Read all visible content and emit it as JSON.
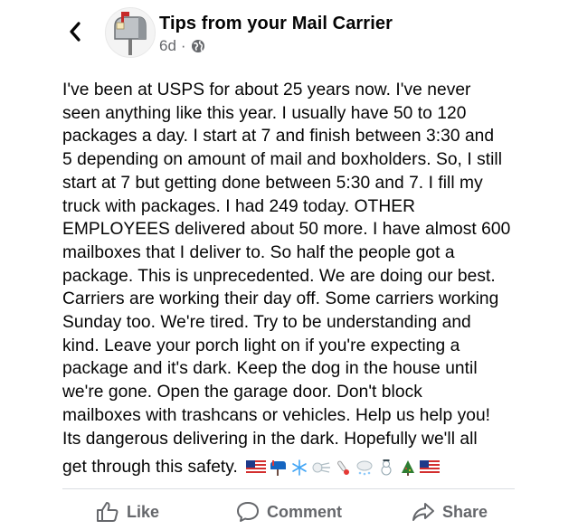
{
  "header": {
    "page_name": "Tips from your Mail Carrier",
    "timestamp": "6d",
    "separator": "·",
    "audience_icon": "globe-icon",
    "back_icon": "chevron-left-icon",
    "avatar_icon": "mailbox-avatar"
  },
  "post": {
    "lines": [
      "I've been at USPS for about 25 years now. I've never",
      "seen anything like this year.  I usually have 50 to 120",
      "packages a day. I start at 7 and finish between 3:30 and",
      "5 depending on amount of mail and boxholders. So, I still",
      "start at 7 but getting done between 5:30 and 7. I fill my",
      "truck with packages.  I had 249 today. OTHER",
      "EMPLOYEES delivered about 50 more. I have almost 600",
      "mailboxes that I deliver to.  So half the people got a",
      "package.  This is unprecedented.  We are doing our best.",
      "Carriers are working their day off. Some carriers working",
      "Sunday too. We're tired. Try to be understanding and",
      "kind. Leave your porch light on if you're expecting a",
      "package and it's dark. Keep the dog in the house until",
      "we're gone. Open the garage door. Don't block",
      "mailboxes with trashcans or vehicles. Help us help you!",
      "Its dangerous delivering in the dark. Hopefully we'll all"
    ],
    "last_line": "get through this safety.",
    "emojis": [
      "us-flag-emoji",
      "mailbox-emoji",
      "snowflake-emoji",
      "wind-emoji",
      "thermometer-emoji",
      "snow-cloud-emoji",
      "snowman-emoji",
      "christmas-tree-emoji",
      "us-flag-emoji"
    ]
  },
  "actions": {
    "like": "Like",
    "comment": "Comment",
    "share": "Share"
  },
  "colors": {
    "text": "#050505",
    "secondary": "#65676b",
    "divider": "#dadde1"
  }
}
